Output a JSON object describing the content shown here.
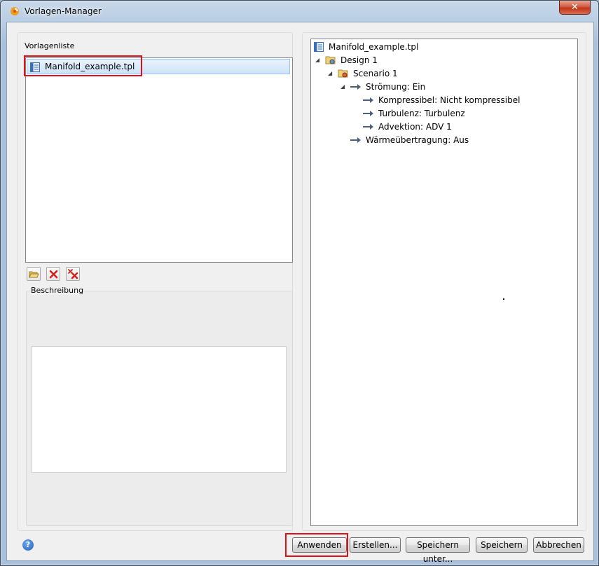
{
  "window": {
    "title": "Vorlagen-Manager",
    "close_glyph": "✕"
  },
  "left": {
    "list_label": "Vorlagenliste",
    "items": [
      {
        "label": "Manifold_example.tpl",
        "selected": true
      }
    ],
    "toolbar": {
      "open_icon": "folder-open-icon",
      "delete_icon": "delete-icon",
      "delete_all_icon": "delete-all-icon"
    },
    "description_label": "Beschreibung",
    "description_value": ""
  },
  "tree": {
    "root": "Manifold_example.tpl",
    "design": "Design 1",
    "scenario": "Scenario 1",
    "flow": "Strömung: Ein",
    "compressible": "Kompressibel: Nicht kompressibel",
    "turbulence": "Turbulenz: Turbulenz",
    "advection": "Advektion: ADV 1",
    "heat_transfer": "Wärmeübertragung: Aus"
  },
  "buttons": {
    "apply": "Anwenden",
    "create": "Erstellen...",
    "save_as": "Speichern unter...",
    "save": "Speichern",
    "cancel": "Abbrechen"
  },
  "help_glyph": "?",
  "colors": {
    "highlight": "#e0101a",
    "selection": "#cde3f8",
    "arrow": "#4a5f7a"
  }
}
